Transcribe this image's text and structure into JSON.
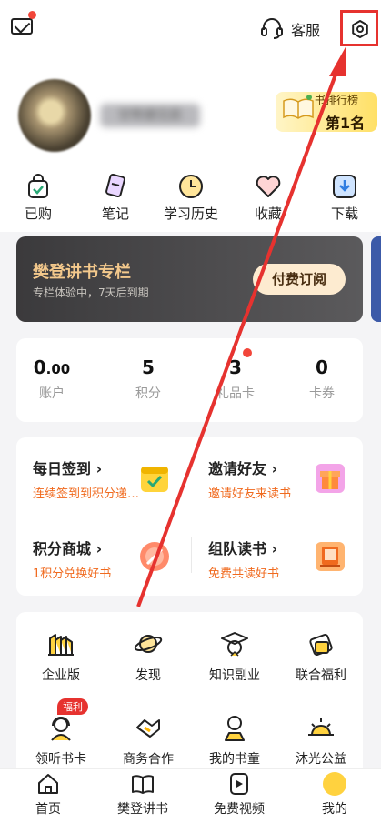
{
  "header": {
    "service_label": "客服",
    "mail_badge": true
  },
  "profile": {
    "username": "甘熊健见辰",
    "rank_title": "书排行榜",
    "rank_value": "第1名"
  },
  "quick_actions": [
    {
      "label": "已购",
      "icon": "bag-check-icon"
    },
    {
      "label": "笔记",
      "icon": "note-pen-icon"
    },
    {
      "label": "学习历史",
      "icon": "clock-icon"
    },
    {
      "label": "收藏",
      "icon": "heart-icon"
    },
    {
      "label": "下载",
      "icon": "download-icon"
    }
  ],
  "banner": {
    "title": "樊登讲书专栏",
    "subtitle": "专栏体验中，7天后到期",
    "button": "付费订阅"
  },
  "stats": [
    {
      "value_main": "0",
      "value_decimal": ".00",
      "label": "账户"
    },
    {
      "value_main": "5",
      "value_decimal": "",
      "label": "积分"
    },
    {
      "value_main": "3",
      "value_decimal": "",
      "label": "礼品卡"
    },
    {
      "value_main": "0",
      "value_decimal": "",
      "label": "卡券"
    }
  ],
  "tasks": [
    {
      "title": "每日签到",
      "subtitle": "连续签到到积分递…",
      "icon": "calendar-check-icon"
    },
    {
      "title": "邀请好友",
      "subtitle": "邀请好友来读书",
      "icon": "gift-icon"
    },
    {
      "title": "积分商城",
      "subtitle": "1积分兑换好书",
      "icon": "points-coin-icon"
    },
    {
      "title": "组队读书",
      "subtitle": "免费共读好书",
      "icon": "book-stand-icon"
    }
  ],
  "services": [
    {
      "label": "企业版",
      "icon": "building-icon"
    },
    {
      "label": "发现",
      "icon": "planet-icon"
    },
    {
      "label": "知识副业",
      "icon": "graduation-cap-icon"
    },
    {
      "label": "联合福利",
      "icon": "coupon-icon"
    },
    {
      "label": "领听书卡",
      "icon": "headphone-person-icon"
    },
    {
      "label": "商务合作",
      "icon": "handshake-icon"
    },
    {
      "label": "我的书童",
      "icon": "child-reader-icon"
    },
    {
      "label": "沐光公益",
      "icon": "sunrise-icon"
    }
  ],
  "welfare_badge": "福利",
  "tabs": [
    {
      "label": "首页",
      "icon": "home-icon"
    },
    {
      "label": "樊登讲书",
      "icon": "open-book-icon"
    },
    {
      "label": "免费视频",
      "icon": "video-play-icon"
    },
    {
      "label": "我的",
      "icon": "mine-face-icon"
    }
  ],
  "colors": {
    "accent_red": "#e6322f",
    "task_orange": "#f06a1e",
    "banner_gold": "#f4c98c",
    "banner_dark": "#3b3a3c"
  }
}
